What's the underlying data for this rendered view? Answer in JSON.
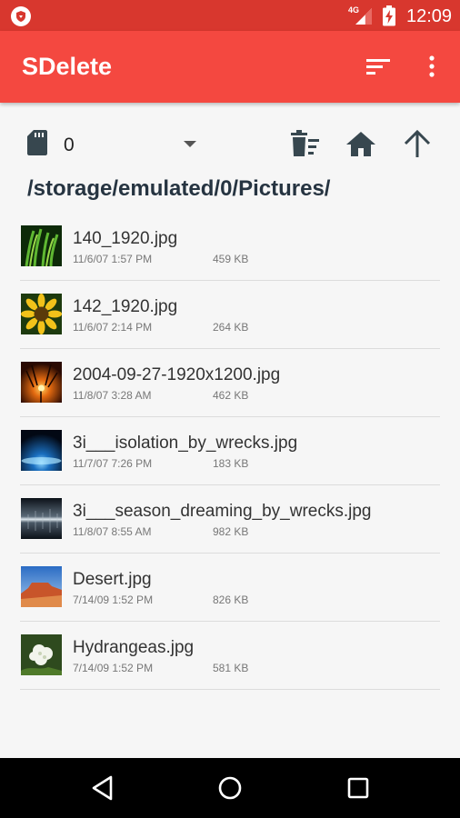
{
  "status_bar": {
    "network_label": "4G",
    "time": "12:09"
  },
  "app_bar": {
    "title": "SDelete",
    "actions": [
      {
        "icon": "sort-icon"
      },
      {
        "icon": "more-vert-icon"
      }
    ]
  },
  "toolbar": {
    "storage_icon": "sd-card-icon",
    "storage_value": "0",
    "actions": [
      {
        "icon": "delete-sweep-icon"
      },
      {
        "icon": "home-icon"
      },
      {
        "icon": "arrow-up-icon"
      }
    ]
  },
  "current_path": "/storage/emulated/0/Pictures/",
  "files": [
    {
      "name": "140_1920.jpg",
      "date": "11/6/07  1:57 PM",
      "size": "459 KB",
      "thumbnail": "green-plant"
    },
    {
      "name": "142_1920.jpg",
      "date": "11/6/07  2:14 PM",
      "size": "264 KB",
      "thumbnail": "sunflower"
    },
    {
      "name": "2004-09-27-1920x1200.jpg",
      "date": "11/8/07  3:28 AM",
      "size": "462 KB",
      "thumbnail": "sunset"
    },
    {
      "name": "3i___isolation_by_wrecks.jpg",
      "date": "11/7/07  7:26 PM",
      "size": "183 KB",
      "thumbnail": "blue-glow"
    },
    {
      "name": "3i___season_dreaming_by_wrecks.jpg",
      "date": "11/8/07  8:55 AM",
      "size": "982 KB",
      "thumbnail": "grey-streak"
    },
    {
      "name": "Desert.jpg",
      "date": "7/14/09  1:52 PM",
      "size": "826 KB",
      "thumbnail": "desert"
    },
    {
      "name": "Hydrangeas.jpg",
      "date": "7/14/09  1:52 PM",
      "size": "581 KB",
      "thumbnail": "hydrangea"
    }
  ],
  "nav_bar": {
    "buttons": [
      {
        "icon": "back-icon"
      },
      {
        "icon": "home-circle-icon"
      },
      {
        "icon": "recents-icon"
      }
    ]
  },
  "colors": {
    "status_bar": "#d8372e",
    "app_bar": "#f44840",
    "path_text": "#263441",
    "icon_dark": "#37474f"
  }
}
